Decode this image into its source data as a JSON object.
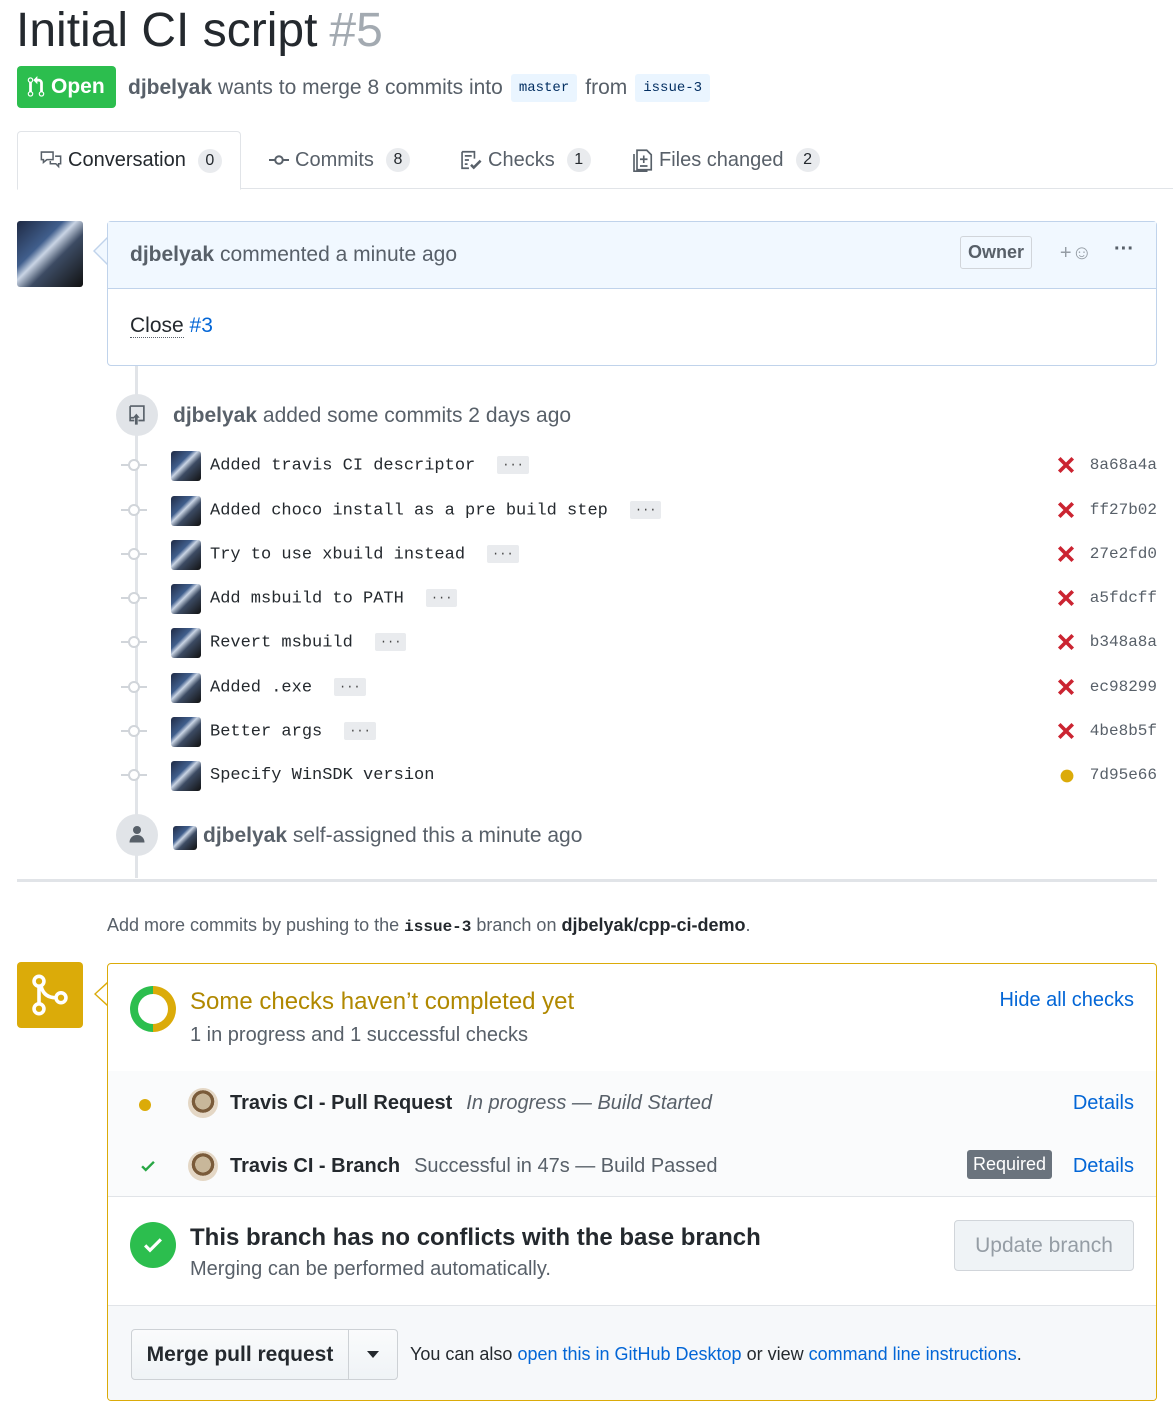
{
  "pr": {
    "title": "Initial CI script",
    "number": "#5",
    "state": "Open",
    "author": "djbelyak",
    "merge_text": "wants to merge 8 commits into",
    "base": "master",
    "from_text": "from",
    "head": "issue-3"
  },
  "tabs": [
    {
      "label": "Conversation",
      "count": "0",
      "icon": "comment-discussion-icon"
    },
    {
      "label": "Commits",
      "count": "8",
      "icon": "git-commit-icon"
    },
    {
      "label": "Checks",
      "count": "1",
      "icon": "checklist-icon"
    },
    {
      "label": "Files changed",
      "count": "2",
      "icon": "diff-icon"
    }
  ],
  "comment": {
    "author": "djbelyak",
    "action": "commented a minute ago",
    "badge": "Owner",
    "reaction": "+☺",
    "more": "···",
    "body_prefix": "Close",
    "issue_link": "#3"
  },
  "event_commits": {
    "author": "djbelyak",
    "text": "added some commits 2 days ago",
    "ellipsis": "···"
  },
  "commits": [
    {
      "message": "Added travis CI descriptor",
      "sha": "8a68a4a",
      "status": "failure"
    },
    {
      "message": "Added choco install as a pre build step",
      "sha": "ff27b02",
      "status": "failure"
    },
    {
      "message": "Try to use xbuild instead",
      "sha": "27e2fd0",
      "status": "failure"
    },
    {
      "message": "Add msbuild to PATH",
      "sha": "a5fdcff",
      "status": "failure"
    },
    {
      "message": "Revert msbuild",
      "sha": "b348a8a",
      "status": "failure"
    },
    {
      "message": "Added .exe",
      "sha": "ec98299",
      "status": "failure"
    },
    {
      "message": "Better args",
      "sha": "4be8b5f",
      "status": "failure"
    },
    {
      "message": "Specify WinSDK version",
      "sha": "7d95e66",
      "status": "pending"
    }
  ],
  "event_assign": {
    "author": "djbelyak",
    "text": "self-assigned this a minute ago"
  },
  "hint": {
    "prefix": "Add more commits by pushing to the",
    "branch": "issue-3",
    "middle": "branch on",
    "repo": "djbelyak/cpp-ci-demo",
    "suffix": "."
  },
  "checks": {
    "title": "Some checks haven’t completed yet",
    "subtitle": "1 in progress and 1 successful checks",
    "toggle": "Hide all checks",
    "progress_fraction": 0.5,
    "items": [
      {
        "name": "Travis CI - Pull Request",
        "desc": "In progress — Build Started",
        "status": "pending",
        "details": "Details"
      },
      {
        "name": "Travis CI - Branch",
        "desc": "Successful in 47s — Build Passed",
        "status": "success",
        "required": "Required",
        "details": "Details"
      }
    ]
  },
  "conflicts": {
    "title": "This branch has no conflicts with the base branch",
    "subtitle": "Merging can be performed automatically.",
    "update_button": "Update branch"
  },
  "merge": {
    "button": "Merge pull request",
    "also": "You can also",
    "desktop_link": "open this in GitHub Desktop",
    "or_view": "or view",
    "cli_link": "command line instructions",
    "end": "."
  },
  "colors": {
    "open_green": "#2cbe4e",
    "pending_yellow": "#dbab09",
    "failure_red": "#cb2431",
    "link_blue": "#0366d6"
  }
}
